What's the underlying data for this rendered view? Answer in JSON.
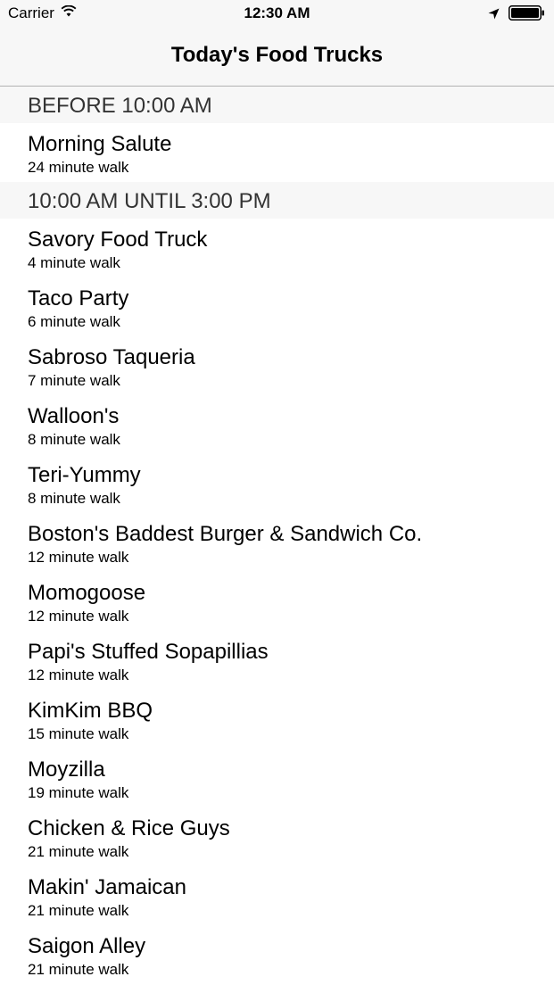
{
  "status_bar": {
    "carrier": "Carrier",
    "time": "12:30 AM"
  },
  "nav": {
    "title": "Today's Food Trucks"
  },
  "sections": [
    {
      "title": "BEFORE 10:00 AM",
      "rows": [
        {
          "name": "Morning Salute",
          "walk": "24 minute walk"
        }
      ]
    },
    {
      "title": "10:00 AM UNTIL 3:00 PM",
      "rows": [
        {
          "name": "Savory Food Truck",
          "walk": "4 minute walk"
        },
        {
          "name": "Taco Party",
          "walk": "6 minute walk"
        },
        {
          "name": "Sabroso Taqueria",
          "walk": "7 minute walk"
        },
        {
          "name": "Walloon's",
          "walk": "8 minute walk"
        },
        {
          "name": "Teri-Yummy",
          "walk": "8 minute walk"
        },
        {
          "name": "Boston's Baddest Burger & Sandwich Co.",
          "walk": "12 minute walk"
        },
        {
          "name": "Momogoose",
          "walk": "12 minute walk"
        },
        {
          "name": "Papi's Stuffed Sopapillias",
          "walk": "12 minute walk"
        },
        {
          "name": "KimKim BBQ",
          "walk": "15 minute walk"
        },
        {
          "name": "Moyzilla",
          "walk": "19 minute walk"
        },
        {
          "name": "Chicken & Rice Guys",
          "walk": "21 minute walk"
        },
        {
          "name": "Makin' Jamaican",
          "walk": "21 minute walk"
        },
        {
          "name": "Saigon Alley",
          "walk": "21 minute walk"
        }
      ]
    }
  ]
}
